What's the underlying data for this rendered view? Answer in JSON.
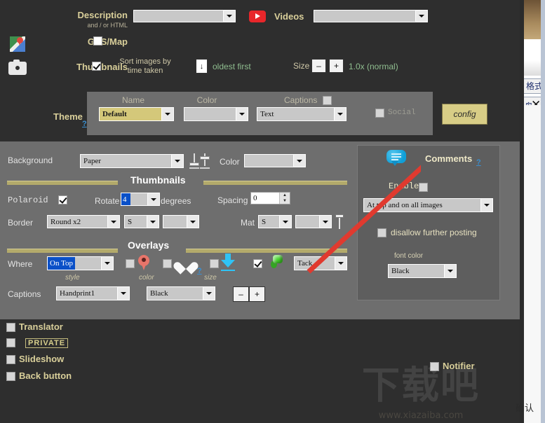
{
  "top": {
    "description_label": "Description",
    "description_sub": "and / or HTML",
    "description_value": "",
    "videos_label": "Videos",
    "videos_value": "",
    "gpsmap_label": "GPS/Map",
    "gpsmap_checked": false,
    "thumbnails_label": "Thumbnails",
    "thumbnails_checked": true,
    "sort_label": "Sort images by time taken",
    "sort_dir_glyph": "↓",
    "sort_order_label": "oldest first",
    "size_label": "Size",
    "size_minus": "–",
    "size_plus": "+",
    "size_value": "1.0x (normal)",
    "youtube_icon": "youtube-icon",
    "gmap_icon": "google-maps-icon",
    "camera_icon": "camera-icon"
  },
  "theme": {
    "label": "Theme",
    "help": "?",
    "name_label": "Name",
    "name_value": "Default",
    "color_label": "Color",
    "color_value": "",
    "captions_label": "Captions",
    "captions_checked": false,
    "captions_value": "Text",
    "social_label": "Social",
    "social_checked": false,
    "config_button": "config"
  },
  "background": {
    "label": "Background",
    "value": "Paper",
    "color_label": "Color",
    "color_value": ""
  },
  "thumbnails_section": {
    "title": "Thumbnails",
    "polaroid_label": "Polaroid",
    "polaroid_checked": true,
    "rotate_label": "Rotate",
    "rotate_value": "4",
    "degrees_label": "degrees",
    "spacing_label": "Spacing",
    "spacing_value": "0",
    "border_label": "Border",
    "border_style": "Round x2",
    "border_size": "S",
    "border_color": "",
    "mat_label": "Mat",
    "mat_size": "S",
    "mat_color": ""
  },
  "overlays_section": {
    "title": "Overlays",
    "where_label": "Where",
    "where_value": "On Top",
    "style_label": "style",
    "color_label": "color",
    "size_label": "size",
    "help": "?",
    "pin_checked": false,
    "heart_checked": false,
    "arrow_checked": false,
    "tack_checked": true,
    "tack_value": "Tack",
    "captions_label": "Captions",
    "captions_style": "Handprint1",
    "captions_color": "Black",
    "minus": "–",
    "plus": "+",
    "icons": [
      "map-pin-icon",
      "heart-icon",
      "download-arrow-icon",
      "push-pin-icon"
    ]
  },
  "comments": {
    "title": "Comments",
    "help": "?",
    "bubble_icon": "comment-bubble-icon",
    "enable_label": "Enable",
    "enable_checked": false,
    "position_value": "At top and on all images",
    "disallow_label": "disallow further posting",
    "disallow_checked": false,
    "font_color_label": "font color",
    "font_color_value": "Black"
  },
  "bottom": {
    "translator_label": "Translator",
    "translator_checked": false,
    "private_label": "PRIVATE",
    "private_checked": false,
    "slideshow_label": "Slideshow",
    "slideshow_checked": false,
    "back_button_label": "Back button",
    "back_button_checked": false,
    "notifier_label": "Notifier",
    "notifier_checked": false
  },
  "watermark": {
    "text": "下载吧",
    "url": "www.xiazaiba.com"
  },
  "edge_window": {
    "format_label": "格式",
    "close_glyph": "✕",
    "confirm_label": "确认"
  },
  "colors": {
    "app_bg": "#2e2e2e",
    "panel_bg": "#6e6e6e",
    "comments_bg": "#5e5e5e",
    "gold_label": "#d9cf9a",
    "accent_gold": "#d4c87a",
    "divider": "#b3aa6b",
    "arrow_red": "#e03a2f",
    "link_blue": "#3a8fd0"
  }
}
